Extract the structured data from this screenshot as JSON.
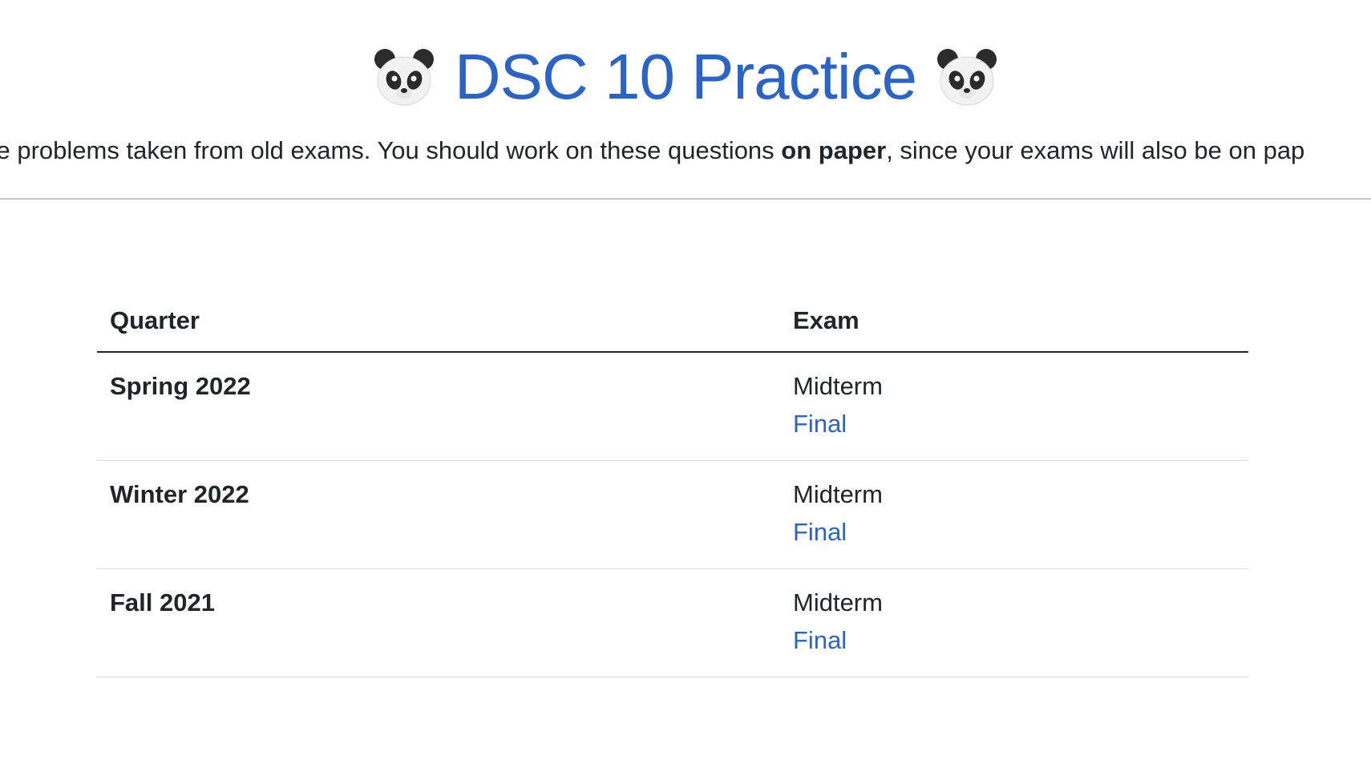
{
  "header": {
    "emoji_left": "panda-face-icon",
    "title": "DSC 10 Practice",
    "emoji_right": "panda-face-icon"
  },
  "intro": {
    "text_before": "ce problems taken from old exams. You should work on these questions ",
    "text_bold": "on paper",
    "text_after": ", since your exams will also be on pap"
  },
  "table": {
    "headers": [
      "Quarter",
      "Exam"
    ],
    "rows": [
      {
        "quarter": "Spring 2022",
        "midterm": "Midterm",
        "final": "Final"
      },
      {
        "quarter": "Winter 2022",
        "midterm": "Midterm",
        "final": "Final"
      },
      {
        "quarter": "Fall 2021",
        "midterm": "Midterm",
        "final": "Final"
      }
    ]
  },
  "colors": {
    "link": "#2a64c6",
    "text": "#212529"
  }
}
